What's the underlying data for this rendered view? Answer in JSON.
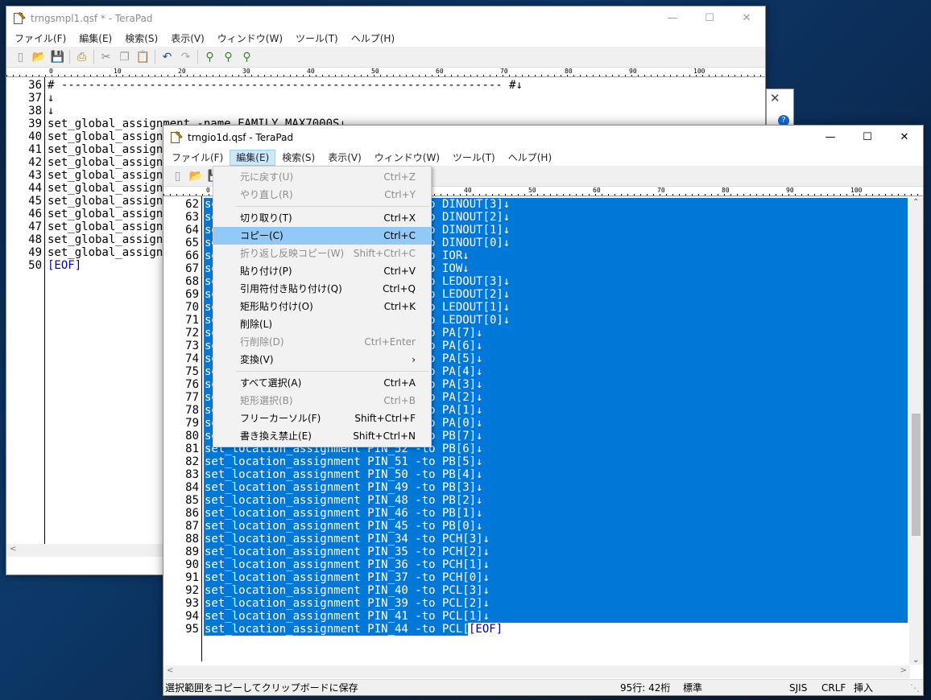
{
  "back_window": {
    "title": "trngsmpl1.qsf * - TeraPad",
    "menus": [
      "ファイル(F)",
      "編集(E)",
      "検索(S)",
      "表示(V)",
      "ウィンドウ(W)",
      "ツール(T)",
      "ヘルプ(H)"
    ],
    "ruler_marks": [
      "0",
      "10",
      "20",
      "30",
      "40",
      "50",
      "60",
      "70",
      "80",
      "90",
      "100"
    ],
    "lines": [
      {
        "n": "36",
        "t": "# ----------------------------------------------------------------- #↓"
      },
      {
        "n": "37",
        "t": "↓"
      },
      {
        "n": "38",
        "t": "↓"
      },
      {
        "n": "39",
        "t": "set_global_assignment -name FAMILY MAX7000S↓"
      },
      {
        "n": "40",
        "t": "set_global_assignment"
      },
      {
        "n": "41",
        "t": "set_global_assignment"
      },
      {
        "n": "42",
        "t": "set_global_assignment"
      },
      {
        "n": "43",
        "t": "set_global_assignment"
      },
      {
        "n": "44",
        "t": "set_global_assignment"
      },
      {
        "n": "45",
        "t": "set_global_assignment"
      },
      {
        "n": "46",
        "t": "set_global_assignment"
      },
      {
        "n": "47",
        "t": "set_global_assignment"
      },
      {
        "n": "48",
        "t": "set_global_assignment"
      },
      {
        "n": "49",
        "t": "set_global_assignment"
      },
      {
        "n": "50",
        "t": "[EOF]"
      }
    ]
  },
  "front_window": {
    "title": "trngio1d.qsf - TeraPad",
    "menus": [
      "ファイル(F)",
      "編集(E)",
      "検索(S)",
      "表示(V)",
      "ウィンドウ(W)",
      "ツール(T)",
      "ヘルプ(H)"
    ],
    "open_menu": "編集(E)",
    "ruler_marks": [
      "0",
      "10",
      "20",
      "30",
      "40",
      "50",
      "60",
      "70",
      "80",
      "90",
      "100"
    ],
    "lines": [
      {
        "n": "62",
        "t": "set_location_assignment PIN_xx -to DINOUT[3]↓"
      },
      {
        "n": "63",
        "t": "set_location_assignment PIN_xx -to DINOUT[2]↓"
      },
      {
        "n": "64",
        "t": "set_location_assignment PIN_xx -to DINOUT[1]↓"
      },
      {
        "n": "65",
        "t": "set_location_assignment PIN_xx -to DINOUT[0]↓"
      },
      {
        "n": "66",
        "t": "set_location_assignment PIN_xx -to IOR↓"
      },
      {
        "n": "67",
        "t": "set_location_assignment PIN_xx -to IOW↓"
      },
      {
        "n": "68",
        "t": "set_location_assignment PIN_xx -to LEDOUT[3]↓"
      },
      {
        "n": "69",
        "t": "set_location_assignment PIN_xx -to LEDOUT[2]↓"
      },
      {
        "n": "70",
        "t": "set_location_assignment PIN_xx -to LEDOUT[1]↓"
      },
      {
        "n": "71",
        "t": "set_location_assignment PIN_xx -to LEDOUT[0]↓"
      },
      {
        "n": "72",
        "t": "set_location_assignment PIN_xx -to PA[7]↓"
      },
      {
        "n": "73",
        "t": "set_location_assignment PIN_xx -to PA[6]↓"
      },
      {
        "n": "74",
        "t": "set_location_assignment PIN_xx -to PA[5]↓"
      },
      {
        "n": "75",
        "t": "set_location_assignment PIN_xx -to PA[4]↓"
      },
      {
        "n": "76",
        "t": "set_location_assignment PIN_xx -to PA[3]↓"
      },
      {
        "n": "77",
        "t": "set_location_assignment PIN_xx -to PA[2]↓"
      },
      {
        "n": "78",
        "t": "set_location_assignment PIN_xx -to PA[1]↓"
      },
      {
        "n": "79",
        "t": "set_location_assignment PIN_xx -to PA[0]↓"
      },
      {
        "n": "80",
        "t": "set_location_assignment PIN_xx -to PB[7]↓"
      },
      {
        "n": "81",
        "t": "set_location_assignment PIN_52 -to PB[6]↓"
      },
      {
        "n": "82",
        "t": "set_location_assignment PIN_51 -to PB[5]↓"
      },
      {
        "n": "83",
        "t": "set_location_assignment PIN_50 -to PB[4]↓"
      },
      {
        "n": "84",
        "t": "set_location_assignment PIN_49 -to PB[3]↓"
      },
      {
        "n": "85",
        "t": "set_location_assignment PIN_48 -to PB[2]↓"
      },
      {
        "n": "86",
        "t": "set_location_assignment PIN_46 -to PB[1]↓"
      },
      {
        "n": "87",
        "t": "set_location_assignment PIN_45 -to PB[0]↓"
      },
      {
        "n": "88",
        "t": "set_location_assignment PIN_34 -to PCH[3]↓"
      },
      {
        "n": "89",
        "t": "set_location_assignment PIN_35 -to PCH[2]↓"
      },
      {
        "n": "90",
        "t": "set_location_assignment PIN_36 -to PCH[1]↓"
      },
      {
        "n": "91",
        "t": "set_location_assignment PIN_37 -to PCH[0]↓"
      },
      {
        "n": "92",
        "t": "set_location_assignment PIN_40 -to PCL[3]↓"
      },
      {
        "n": "93",
        "t": "set_location_assignment PIN_39 -to PCL[2]↓"
      },
      {
        "n": "94",
        "t": "set_location_assignment PIN_41 -to PCL[1]↓"
      },
      {
        "n": "95",
        "t": "set_location_assignment PIN_44 -to PCL[0]"
      }
    ],
    "eof": "[EOF]",
    "status": {
      "message": "選択範囲をコピーしてクリップボードに保存",
      "position": "95行:  42桁",
      "mode": "標準",
      "encoding": "SJIS",
      "line_ending": "CRLF",
      "insert": "挿入"
    }
  },
  "edit_menu": {
    "items": [
      {
        "label": "元に戻す(U)",
        "shortcut": "Ctrl+Z",
        "disabled": true
      },
      {
        "label": "やり直し(R)",
        "shortcut": "Ctrl+Y",
        "disabled": true
      },
      {
        "sep": true
      },
      {
        "label": "切り取り(T)",
        "shortcut": "Ctrl+X"
      },
      {
        "label": "コピー(C)",
        "shortcut": "Ctrl+C",
        "highlight": true
      },
      {
        "label": "折り返し反映コピー(W)",
        "shortcut": "Shift+Ctrl+C",
        "disabled": true
      },
      {
        "label": "貼り付け(P)",
        "shortcut": "Ctrl+V"
      },
      {
        "label": "引用符付き貼り付け(Q)",
        "shortcut": "Ctrl+Q"
      },
      {
        "label": "矩形貼り付け(O)",
        "shortcut": "Ctrl+K"
      },
      {
        "label": "削除(L)",
        "shortcut": ""
      },
      {
        "label": "行削除(D)",
        "shortcut": "Ctrl+Enter",
        "disabled": true
      },
      {
        "label": "変換(V)",
        "shortcut": "›"
      },
      {
        "sep": true
      },
      {
        "label": "すべて選択(A)",
        "shortcut": "Ctrl+A"
      },
      {
        "label": "矩形選択(B)",
        "shortcut": "Ctrl+B",
        "disabled": true
      },
      {
        "label": "フリーカーソル(F)",
        "shortcut": "Shift+Ctrl+F"
      },
      {
        "label": "書き換え禁止(E)",
        "shortcut": "Shift+Ctrl+N"
      }
    ]
  },
  "colors": {
    "selection": "#0078d7",
    "menu_highlight": "#91c9f7"
  }
}
